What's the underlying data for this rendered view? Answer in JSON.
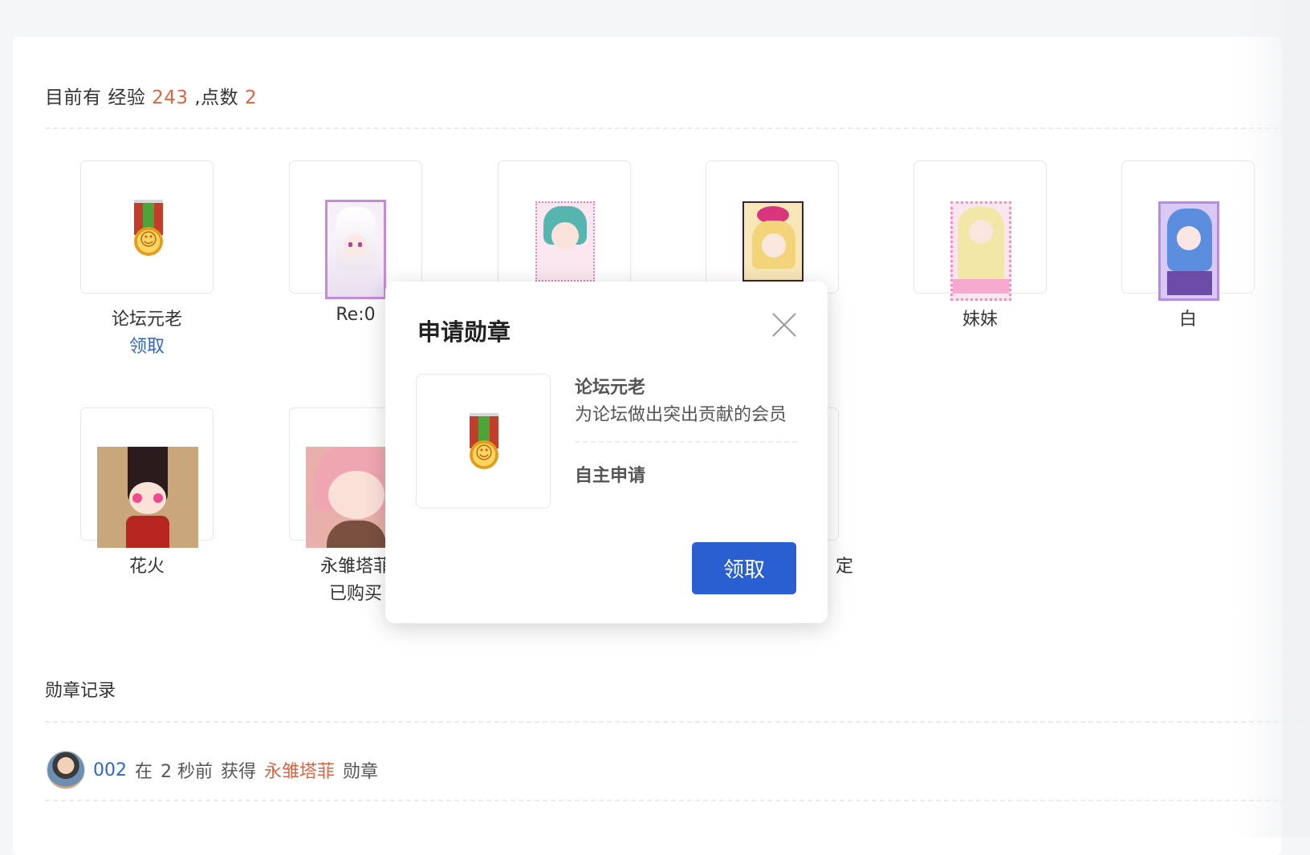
{
  "stats": {
    "prefix": "目前有",
    "exp_label": "经验",
    "exp_value": "243",
    "separator": ",",
    "points_label": "点数",
    "points_value": "2"
  },
  "medals": [
    {
      "name": "论坛元老",
      "action": "领取",
      "image": "gold-medal-icon"
    },
    {
      "name": "Re:0",
      "action": "",
      "image": "rem-card-image"
    },
    {
      "name": "",
      "action": "",
      "image": "miku-card-image"
    },
    {
      "name": "",
      "action": "",
      "image": "flower-girl-card-image"
    },
    {
      "name": "妹妹",
      "action": "",
      "image": "sister-card-image"
    },
    {
      "name": "白",
      "action": "",
      "image": "shiro-card-image"
    },
    {
      "name": "花火",
      "action": "",
      "image": "hanabi-image"
    },
    {
      "name": "永雏塔菲",
      "action": "已购买",
      "image": "taffy-image"
    },
    {
      "name": "",
      "action": "",
      "image": "hidden-medal"
    },
    {
      "name": "定",
      "action": "",
      "image": "hidden-medal"
    }
  ],
  "records": {
    "title": "勋章记录",
    "items": [
      {
        "user": "002",
        "text_in": "在",
        "time": "2 秒前",
        "text_get": "获得",
        "medal": "永雏塔菲",
        "suffix": "勋章"
      }
    ]
  },
  "modal": {
    "title": "申请勋章",
    "medal_name": "论坛元老",
    "medal_desc": "为论坛做出突出贡献的会员",
    "apply_type": "自主申请",
    "button": "领取"
  },
  "colors": {
    "accent": "#e0623f",
    "link": "#2c66c8",
    "primary_button": "#2a5fd1"
  }
}
